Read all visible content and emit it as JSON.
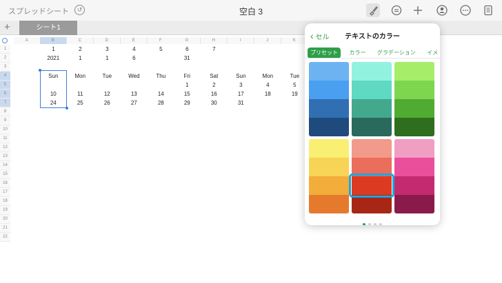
{
  "toolbar": {
    "back_label": "スプレッドシート",
    "title": "空白 3",
    "undo_glyph": "↺",
    "icons": [
      "paintbrush-icon",
      "comment-icon",
      "plus-icon",
      "share-user-icon",
      "more-icon",
      "document-icon"
    ]
  },
  "sheets": {
    "add_glyph": "+",
    "active_tab": "シート1"
  },
  "grid": {
    "columns": [
      "A",
      "B",
      "C",
      "D",
      "E",
      "F",
      "G",
      "H",
      "I",
      "J",
      "K"
    ],
    "rows": [
      "1",
      "2",
      "3",
      "4",
      "5",
      "6",
      "7",
      "8",
      "9",
      "10",
      "11",
      "12",
      "13",
      "14",
      "15",
      "16",
      "17",
      "18",
      "19",
      "20",
      "21",
      "22"
    ],
    "cells": {
      "r1": [
        "",
        "1",
        "2",
        "3",
        "4",
        "5",
        "6",
        "7",
        "",
        "",
        ""
      ],
      "r2": [
        "",
        "2021",
        "1",
        "1",
        "6",
        "",
        "31",
        "",
        "",
        "",
        ""
      ],
      "r3": [
        "",
        "",
        "",
        "",
        "",
        "",
        "",
        "",
        "",
        "",
        ""
      ],
      "r4": [
        "",
        "Sun",
        "Mon",
        "Tue",
        "Wed",
        "Thu",
        "Fri",
        "Sat",
        "Sun",
        "Mon",
        "Tue"
      ],
      "r5": [
        "",
        "",
        "",
        "",
        "",
        "",
        "1",
        "2",
        "3",
        "4",
        "5"
      ],
      "r6": [
        "",
        "10",
        "11",
        "12",
        "13",
        "14",
        "15",
        "16",
        "17",
        "18",
        "19"
      ],
      "r7": [
        "",
        "24",
        "25",
        "26",
        "27",
        "28",
        "29",
        "30",
        "31",
        "",
        ""
      ]
    }
  },
  "popover": {
    "back_label": "セル",
    "back_glyph": "‹",
    "title": "テキストのカラー",
    "tabs": [
      "プリセット",
      "カラー",
      "グラデーション",
      "イメ"
    ],
    "active_tab_index": 0,
    "swatch_groups": [
      [
        "#6db3f2",
        "#4a9ff0",
        "#2f6fb2",
        "#1f4a7e"
      ],
      [
        "#92f2e0",
        "#5fd9c2",
        "#43a98c",
        "#2a6a5d"
      ],
      [
        "#a6ee6a",
        "#7dd64e",
        "#50ab32",
        "#2e6e1e"
      ],
      [
        "#f9ef72",
        "#f7d356",
        "#f2ad3a",
        "#e57a2c"
      ],
      [
        "#f29a8c",
        "#ea6e5b",
        "#dd3a22",
        "#a82616"
      ],
      [
        "#f19ec3",
        "#e94f9b",
        "#c42a6f",
        "#8a1a4b"
      ]
    ],
    "selected_swatch": {
      "group": 4,
      "index": 2
    },
    "page_count": 4,
    "page_index": 0
  }
}
